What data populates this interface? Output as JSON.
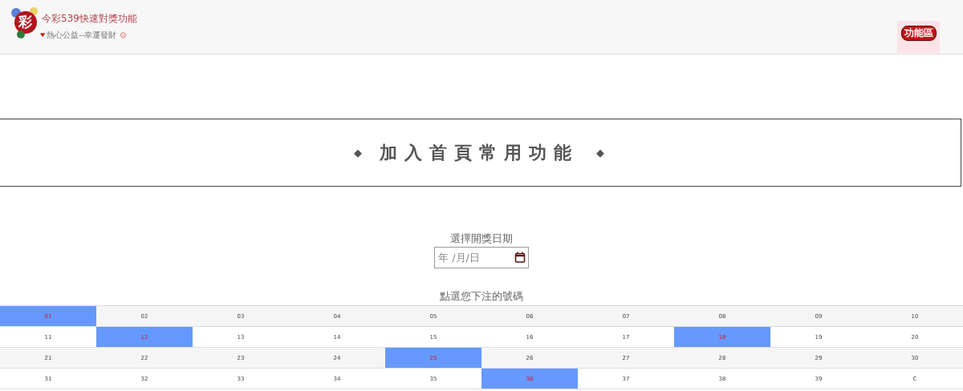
{
  "header": {
    "logo_char": "彩",
    "title": "今彩539快速對獎功能",
    "tagline": "熱心公益--幸運發財",
    "tagline_heart": "♥",
    "tagline_smile": "☺",
    "menu_button": "功能區"
  },
  "banner": {
    "left_mark": "◆",
    "title": "加入首頁常用功能",
    "right_mark": "◆"
  },
  "date": {
    "label": "選擇開獎日期",
    "placeholder": "年 /月/日"
  },
  "numbers": {
    "label": "點選您下注的號碼",
    "cells": [
      {
        "text": "01",
        "selected": true
      },
      {
        "text": "02",
        "selected": false
      },
      {
        "text": "03",
        "selected": false
      },
      {
        "text": "04",
        "selected": false
      },
      {
        "text": "05",
        "selected": false
      },
      {
        "text": "06",
        "selected": false
      },
      {
        "text": "07",
        "selected": false
      },
      {
        "text": "08",
        "selected": false
      },
      {
        "text": "09",
        "selected": false
      },
      {
        "text": "10",
        "selected": false
      },
      {
        "text": "11",
        "selected": false
      },
      {
        "text": "12",
        "selected": true
      },
      {
        "text": "13",
        "selected": false
      },
      {
        "text": "14",
        "selected": false
      },
      {
        "text": "15",
        "selected": false
      },
      {
        "text": "16",
        "selected": false
      },
      {
        "text": "17",
        "selected": false
      },
      {
        "text": "18",
        "selected": true
      },
      {
        "text": "19",
        "selected": false
      },
      {
        "text": "20",
        "selected": false
      },
      {
        "text": "21",
        "selected": false
      },
      {
        "text": "22",
        "selected": false
      },
      {
        "text": "23",
        "selected": false
      },
      {
        "text": "24",
        "selected": false
      },
      {
        "text": "25",
        "selected": true
      },
      {
        "text": "26",
        "selected": false
      },
      {
        "text": "27",
        "selected": false
      },
      {
        "text": "28",
        "selected": false
      },
      {
        "text": "29",
        "selected": false
      },
      {
        "text": "30",
        "selected": false
      },
      {
        "text": "31",
        "selected": false
      },
      {
        "text": "32",
        "selected": false
      },
      {
        "text": "33",
        "selected": false
      },
      {
        "text": "34",
        "selected": false
      },
      {
        "text": "35",
        "selected": false
      },
      {
        "text": "36",
        "selected": true
      },
      {
        "text": "37",
        "selected": false
      },
      {
        "text": "38",
        "selected": false
      },
      {
        "text": "39",
        "selected": false
      },
      {
        "text": "C",
        "selected": false
      }
    ]
  }
}
